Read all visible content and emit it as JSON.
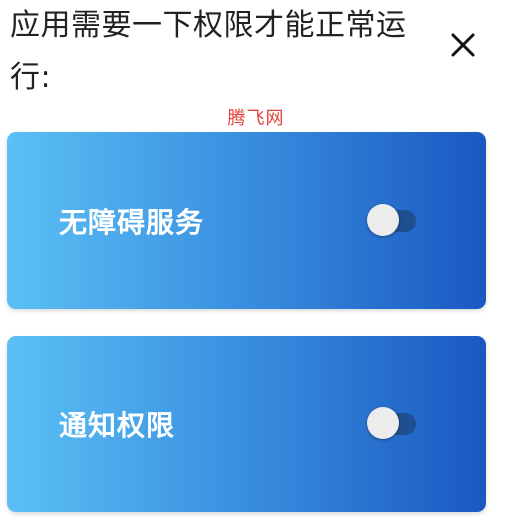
{
  "header": {
    "title": "应用需要一下权限才能正常运行:",
    "close_icon": "close-icon"
  },
  "watermark": {
    "text": "腾飞网",
    "color": "#e3403a"
  },
  "permissions": [
    {
      "label": "无障碍服务",
      "enabled": false
    },
    {
      "label": "通知权限",
      "enabled": false
    }
  ],
  "colors": {
    "card_gradient_start": "#5bc0f4",
    "card_gradient_end": "#1a58c1",
    "toggle_track_off": "#1f4f8e",
    "toggle_thumb": "#ececec"
  }
}
